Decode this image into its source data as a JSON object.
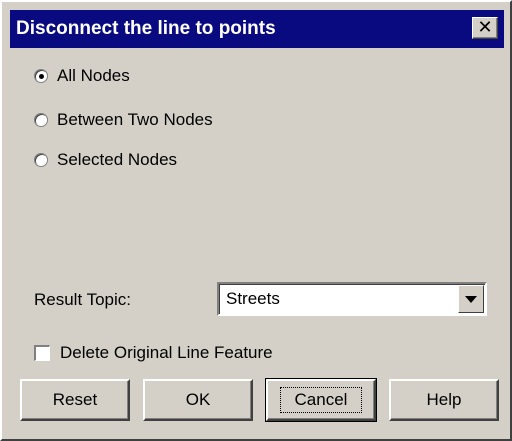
{
  "window": {
    "title": "Disconnect the line to points",
    "close_symbol": "✕"
  },
  "options": {
    "items": [
      {
        "label": "All Nodes",
        "checked": true
      },
      {
        "label": "Between Two Nodes",
        "checked": false
      },
      {
        "label": "Selected Nodes",
        "checked": false
      }
    ]
  },
  "result": {
    "label": "Result Topic:",
    "value": "Streets"
  },
  "delete_original": {
    "label": "Delete Original Line Feature",
    "checked": false
  },
  "buttons": {
    "reset": "Reset",
    "ok": "OK",
    "cancel": "Cancel",
    "help": "Help"
  },
  "colors": {
    "title_bar": "#0a0a80",
    "dialog_bg": "#d4d0c8"
  },
  "icons": {
    "close": "close-icon",
    "dropdown": "chevron-down-icon"
  }
}
